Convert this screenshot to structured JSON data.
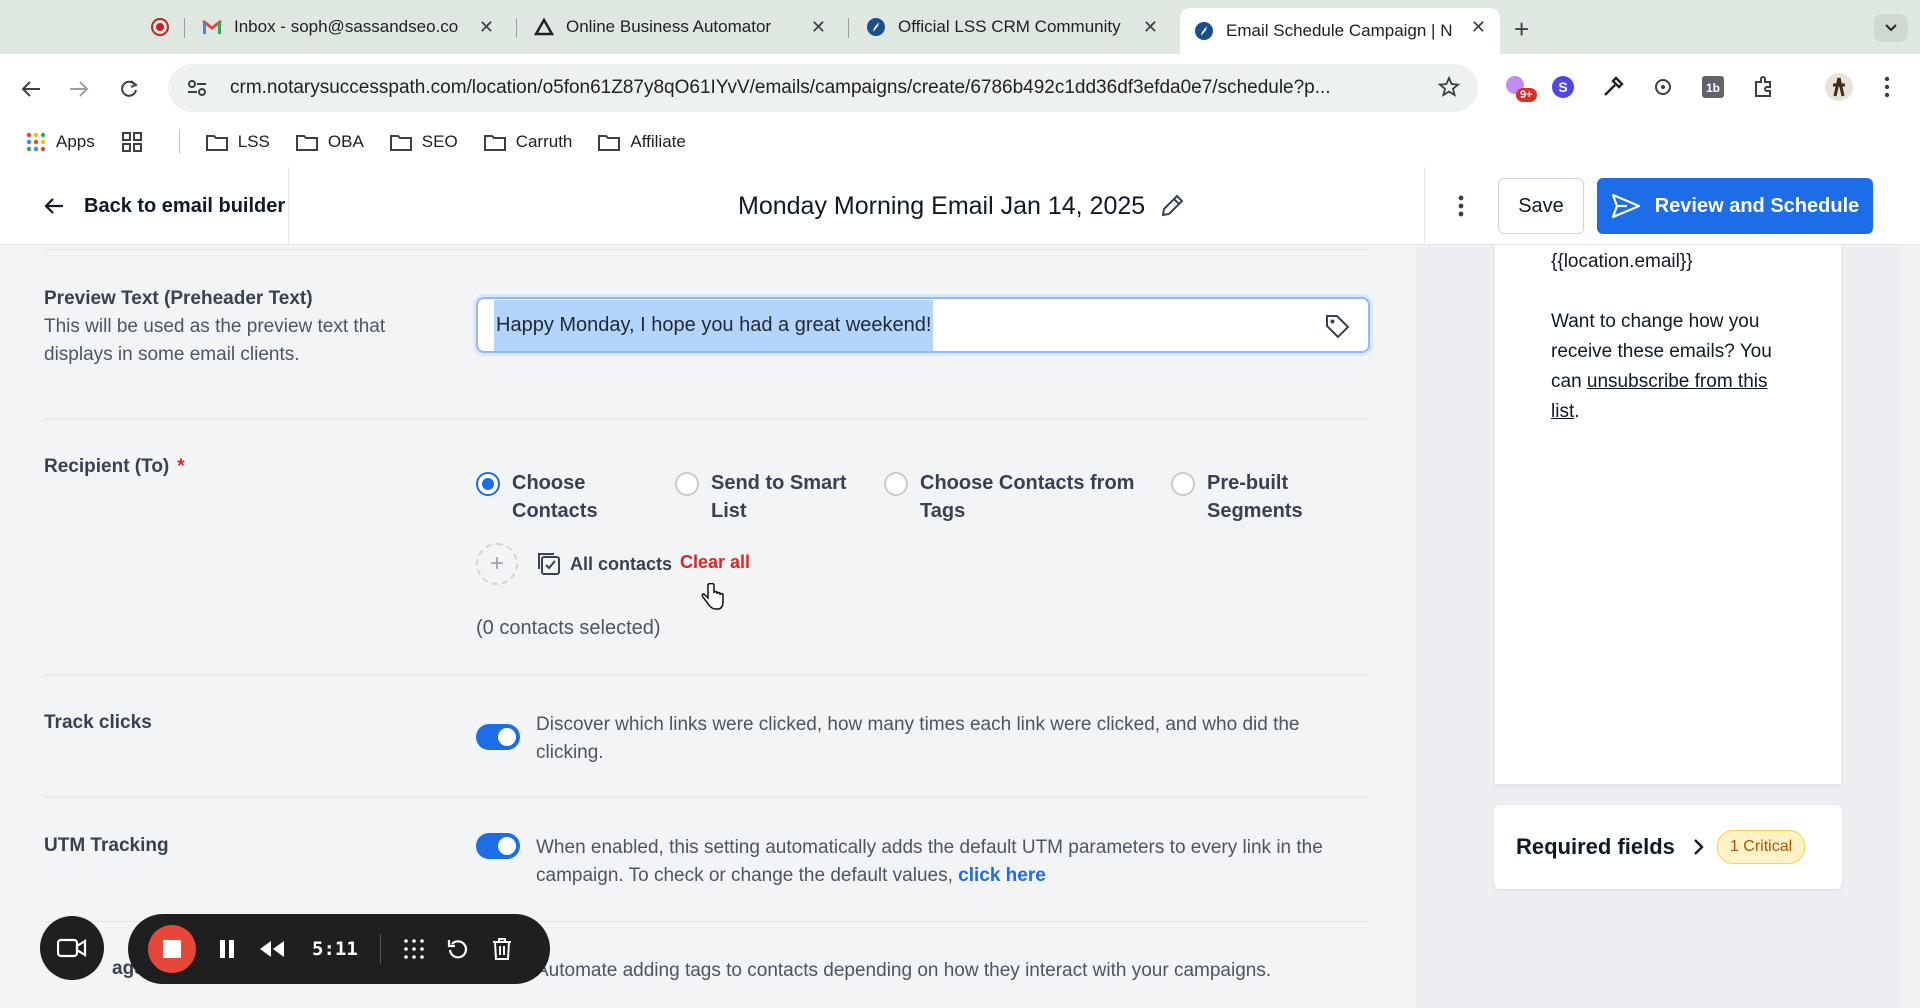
{
  "browser": {
    "tabs": [
      {
        "title": "",
        "icon": "record-icon"
      },
      {
        "title": "Inbox - soph@sassandseo.co",
        "icon": "gmail-icon"
      },
      {
        "title": "Online Business Automator",
        "icon": "triangle-logo-icon"
      },
      {
        "title": "Official LSS CRM Community",
        "icon": "compass-logo-icon"
      },
      {
        "title": "Email Schedule Campaign | N",
        "icon": "compass-logo-icon"
      }
    ],
    "url": "crm.notarysuccesspath.com/location/o5fon61Z87y8qO61IYvV/emails/campaigns/create/6786b492c1dd36df3efda0e7/schedule?p...",
    "extension_badge": "9+",
    "bookmarks": [
      "Apps",
      "LSS",
      "OBA",
      "SEO",
      "Carruth",
      "Affiliate"
    ]
  },
  "header": {
    "back_label": "Back to email builder",
    "title": "Monday Morning Email Jan 14, 2025",
    "save_label": "Save",
    "review_label": "Review and Schedule"
  },
  "preview_text": {
    "label": "Preview Text (Preheader Text)",
    "help": "This will be used as the preview text that displays in some email clients.",
    "value": "Happy Monday, I hope you had a great weekend!"
  },
  "recipient": {
    "label": "Recipient (To)",
    "required_mark": "*",
    "options": [
      {
        "label": "Choose Contacts",
        "checked": true
      },
      {
        "label": "Send to Smart List",
        "checked": false
      },
      {
        "label": "Choose Contacts from Tags",
        "checked": false
      },
      {
        "label": "Pre-built Segments",
        "checked": false
      }
    ],
    "all_contacts_label": "All contacts",
    "clear_all_label": "Clear all",
    "selected_text": "(0 contacts selected)"
  },
  "track_clicks": {
    "label": "Track clicks",
    "enabled": true,
    "description": "Discover which links were clicked, how many times each link were clicked, and who did the clicking."
  },
  "utm": {
    "label": "UTM Tracking",
    "enabled": true,
    "description": "When enabled, this setting automatically adds the default UTM parameters to every link in the campaign. To check or change the default values,",
    "link_label": "click here"
  },
  "tags_row": {
    "label_partial": "ags",
    "description": "Automate adding tags to contacts depending on how they interact with your campaigns."
  },
  "email_preview": {
    "location_email": "{{location.email}}",
    "change_text": "Want to change how you receive these emails? You can",
    "unsubscribe_link": "unsubscribe from this list",
    "end_punct": "."
  },
  "required_fields": {
    "label": "Required fields",
    "badge": "1 Critical"
  },
  "recorder": {
    "time": "5:11"
  },
  "colors": {
    "primary": "#1d6ce8",
    "danger": "#dc2626",
    "critical_bg": "#fef3c7"
  }
}
